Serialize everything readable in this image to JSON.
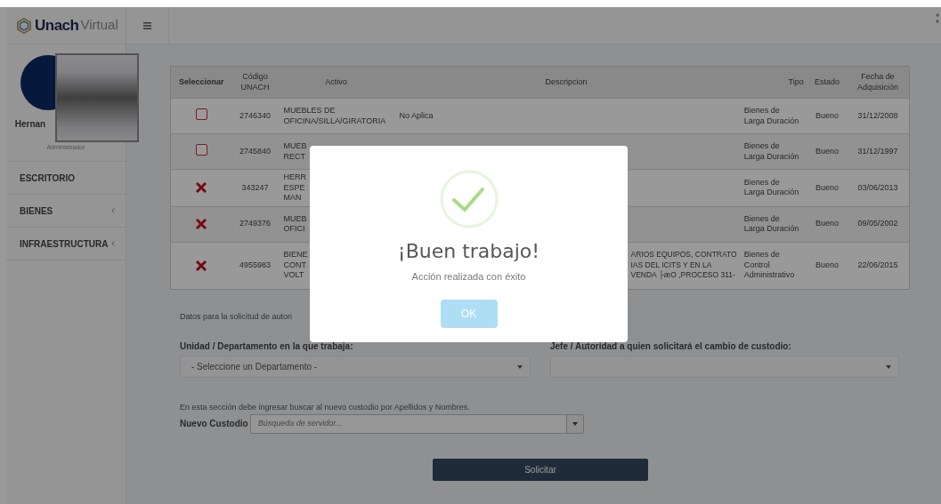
{
  "brand": {
    "bold": "Unach",
    "light": "Virtual"
  },
  "user": {
    "name_lines": [
      "Hernan"
    ],
    "role": "Administrador"
  },
  "sidebar": {
    "items": [
      {
        "label": "ESCRITORIO",
        "expandable": false
      },
      {
        "label": "BIENES",
        "expandable": true
      },
      {
        "label": "INFRAESTRUCTURA",
        "expandable": true
      }
    ]
  },
  "table": {
    "columns": [
      "Seleccionar",
      "Código UNACH",
      "Activo",
      "Descripcion",
      "Tipo",
      "Estado",
      "Fecha de Adquisición"
    ],
    "rows": [
      {
        "kind": "checkbox",
        "code": "2746340",
        "activo_lines": [
          "MUEBLES DE",
          "OFICINA/SILLA/GIRATORIA"
        ],
        "description_lines": [
          "No Aplica"
        ],
        "tipo": "Bienes de Larga Duración",
        "estado": "Bueno",
        "fecha": "31/12/2008"
      },
      {
        "kind": "checkbox",
        "code": "2745840",
        "activo_lines": [
          "MUEB",
          "RECT"
        ],
        "description_lines": [],
        "tipo": "Bienes de Larga Duración",
        "estado": "Bueno",
        "fecha": "31/12/1997"
      },
      {
        "kind": "blocked",
        "code": "343247",
        "activo_lines": [
          "HERR",
          "ESPE",
          "MAN"
        ],
        "description_lines": [],
        "tipo": "Bienes de Larga Duración",
        "estado": "Bueno",
        "fecha": "03/06/2013"
      },
      {
        "kind": "blocked",
        "code": "2749376",
        "activo_lines": [
          "MUEB",
          "OFICI"
        ],
        "description_lines": [],
        "tipo": "Bienes de Larga Duración",
        "estado": "Bueno",
        "fecha": "09/05/2002"
      },
      {
        "kind": "blocked",
        "code": "4955983",
        "activo_lines": [
          "BIENE",
          "CONT",
          "VOLT"
        ],
        "description_lines": [
          "ARIOS EQUIPOS, CONTRATO",
          "IAS DEL ICITS Y EN LA",
          "VENDA ├æO ,PROCESO 311-"
        ],
        "description_cut": true,
        "tipo": "Bienes de Control Administrativo",
        "estado": "Bueno",
        "fecha": "22/06/2015"
      }
    ]
  },
  "form": {
    "intro": "Datos para la solicitud de autori",
    "department_label": "Unidad / Departamento en la que trabaja:",
    "department_value": "- Seleccione un Departamento -",
    "boss_label": "Jefe / Autoridad a quien solicitará el cambio de custodio:",
    "custodian_hint": "En esta sección debe ingresar buscar al nuevo custodio por Apellidos y Nombres.",
    "custodian_label": "Nuevo Custodio",
    "custodian_placeholder": "Búsqueda de servidor...",
    "submit": "Solicitar"
  },
  "dialog": {
    "title": "¡Buen trabajo!",
    "message": "Acción realizada con éxito",
    "button": "OK"
  }
}
